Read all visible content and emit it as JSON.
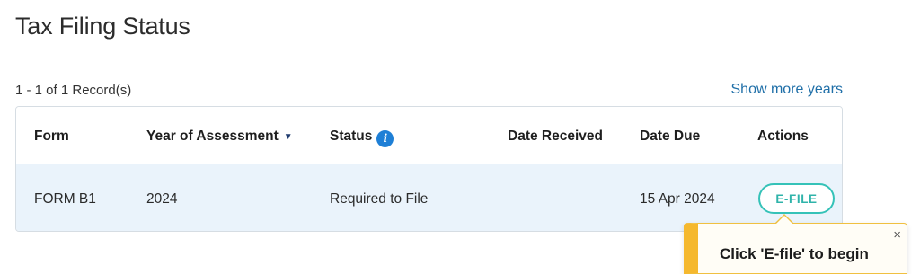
{
  "page": {
    "title": "Tax Filing Status"
  },
  "records": {
    "count_label": "1 - 1 of 1 Record(s)",
    "show_more_label": "Show more years"
  },
  "table": {
    "headers": {
      "form": "Form",
      "year": "Year of Assessment",
      "status": "Status",
      "date_received": "Date Received",
      "date_due": "Date Due",
      "actions": "Actions"
    },
    "sort_icon": "triangle-down",
    "info_icon": "info-circle",
    "rows": [
      {
        "form": "FORM B1",
        "year": "2024",
        "status": "Required to File",
        "date_received": "",
        "date_due": "15 Apr 2024",
        "action_label": "E-FILE"
      }
    ]
  },
  "tooltip": {
    "text": "Click 'E-file' to begin",
    "close_label": "×"
  },
  "colors": {
    "accent_teal": "#35c2b8",
    "link_blue": "#1f6fa8",
    "info_blue": "#1e7fd6",
    "row_highlight": "#eaf3fb",
    "tooltip_accent": "#f5b82e"
  }
}
